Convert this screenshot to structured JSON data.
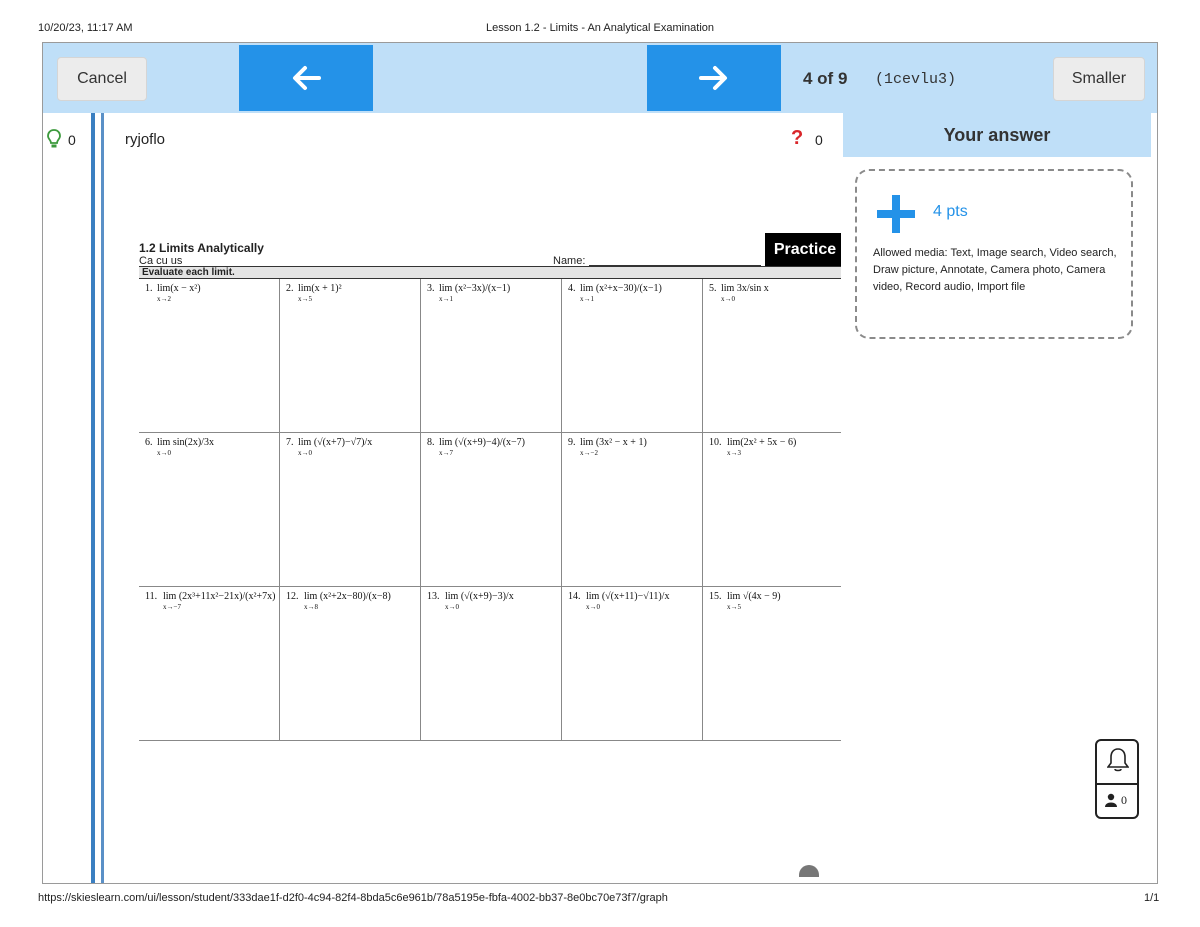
{
  "print_header": {
    "datetime": "10/20/23, 11:17 AM",
    "title": "Lesson 1.2 - Limits - An Analytical Examination"
  },
  "print_footer": {
    "url": "https://skieslearn.com/ui/lesson/student/333dae1f-d2f0-4c94-82f4-8bda5c6e961b/78a5195e-fbfa-4002-bb37-8e0bc70e73f7/graph",
    "page": "1/1"
  },
  "toolbar": {
    "cancel_label": "Cancel",
    "back_icon": "arrow-left-icon",
    "forward_icon": "arrow-right-icon",
    "counter": "4 of 9",
    "code": "(1cevlu3)",
    "smaller_label": "Smaller"
  },
  "left_strip": {
    "hint_icon": "lightbulb-icon",
    "hint_count": "0"
  },
  "workspace": {
    "username": "ryjoflo",
    "help_icon": "question-mark-icon",
    "help_count": "0"
  },
  "worksheet": {
    "title": "1.2 Limits Analytically",
    "course": "Ca cu us",
    "name_label": "Name:",
    "badge": "Practice",
    "instruction": "Evaluate each limit.",
    "problems": [
      {
        "num": "1.",
        "text": "lim(x − x²)",
        "sub": "x→2"
      },
      {
        "num": "2.",
        "text": "lim(x + 1)²",
        "sub": "x→5"
      },
      {
        "num": "3.",
        "text": "lim (x²−3x)/(x−1)",
        "sub": "x→1"
      },
      {
        "num": "4.",
        "text": "lim (x²+x−30)/(x−1)",
        "sub": "x→1"
      },
      {
        "num": "5.",
        "text": "lim 3x/sin x",
        "sub": "x→0"
      },
      {
        "num": "6.",
        "text": "lim sin(2x)/3x",
        "sub": "x→0"
      },
      {
        "num": "7.",
        "text": "lim (√(x+7)−√7)/x",
        "sub": "x→0"
      },
      {
        "num": "8.",
        "text": "lim (√(x+9)−4)/(x−7)",
        "sub": "x→7"
      },
      {
        "num": "9.",
        "text": "lim (3x² − x + 1)",
        "sub": "x→−2"
      },
      {
        "num": "10.",
        "text": "lim(2x² + 5x − 6)",
        "sub": "x→3"
      },
      {
        "num": "11.",
        "text": "lim (2x³+11x²−21x)/(x²+7x)",
        "sub": "x→−7"
      },
      {
        "num": "12.",
        "text": "lim (x²+2x−80)/(x−8)",
        "sub": "x→8"
      },
      {
        "num": "13.",
        "text": "lim (√(x+9)−3)/x",
        "sub": "x→0"
      },
      {
        "num": "14.",
        "text": "lim (√(x+11)−√11)/x",
        "sub": "x→0"
      },
      {
        "num": "15.",
        "text": "lim √(4x − 9)",
        "sub": "x→5"
      }
    ]
  },
  "answer_panel": {
    "header": "Your answer",
    "add_icon": "plus-icon",
    "points": "4 pts",
    "allowed_media": "Allowed media: Text, Image search, Video search, Draw picture, Annotate, Camera photo, Camera video, Record audio, Import file"
  },
  "notification": {
    "bell_icon": "bell-icon",
    "person_icon": "person-icon",
    "count": "0"
  },
  "colors": {
    "toolbar_bg": "#bfdff8",
    "accent_blue": "#2492e8",
    "hint_green": "#3c9a3c",
    "help_red": "#d9262a"
  }
}
